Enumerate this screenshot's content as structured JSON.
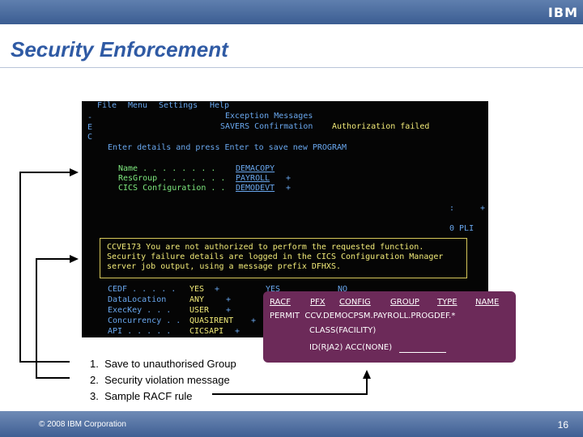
{
  "brand": {
    "logo_text": "IBM"
  },
  "slide": {
    "title": "Security Enforcement"
  },
  "terminal": {
    "menu": [
      "File",
      "Menu",
      "Settings",
      "Help"
    ],
    "side_letters": [
      "-",
      "E",
      "C"
    ],
    "exception_title": "Exception Messages",
    "confirmation": "SAVERS Confirmation",
    "auth_failed": "Authorization failed",
    "instruction": "Enter details and press Enter to save new PROGRAM",
    "fields": [
      {
        "label": "Name . . . . . . . .",
        "value": "DEMACOPY",
        "suffix": ""
      },
      {
        "label": "ResGroup . . . . . . .",
        "value": "PAYROLL",
        "suffix": "+"
      },
      {
        "label": "CICS Configuration . .",
        "value": "DEMODEVT",
        "suffix": "+"
      }
    ],
    "right_colon": ":",
    "right_plus": "+",
    "right_label": "0 PLI",
    "popup_lines": [
      "CCVE173 You are not authorized to perform the requested function.",
      "Security failure details are logged in the CICS Configuration Manager",
      "server job output, using a message prefix DFHXS."
    ],
    "bottom_rows": [
      {
        "label": "CEDF . . . . .",
        "value": "YES",
        "mark": "+"
      },
      {
        "label": "DataLocation",
        "value": "ANY",
        "mark": "+"
      },
      {
        "label": "ExecKey . . .",
        "value": "USER",
        "mark": "+"
      },
      {
        "label": "Concurrency . .",
        "value": "QUASIRENT",
        "mark": "+"
      },
      {
        "label": "API . . . . .",
        "value": "CICSAPI",
        "mark": "+"
      }
    ],
    "yes_label": "YES",
    "no_label": "NO"
  },
  "callout": {
    "header": [
      "RACF",
      "PFX",
      "CONFIG",
      "GROUP",
      "TYPE",
      "NAME"
    ],
    "permit_line": "PERMIT  CCV.DEMOCPSM.PAYROLL.PROGDEF.*",
    "class_line": "CLASS(FACILITY)",
    "id_line": "ID(RJA2) ACC(NONE)"
  },
  "list": [
    "1.  Save to unauthorised Group",
    "2.  Security violation message",
    "3.  Sample RACF rule"
  ],
  "footer": {
    "copyright": "© 2008 IBM Corporation",
    "page": "16"
  },
  "colors": {
    "title": "#2f5aa4",
    "callout": "#6c2a59",
    "header_bar": "#3b5d92"
  }
}
